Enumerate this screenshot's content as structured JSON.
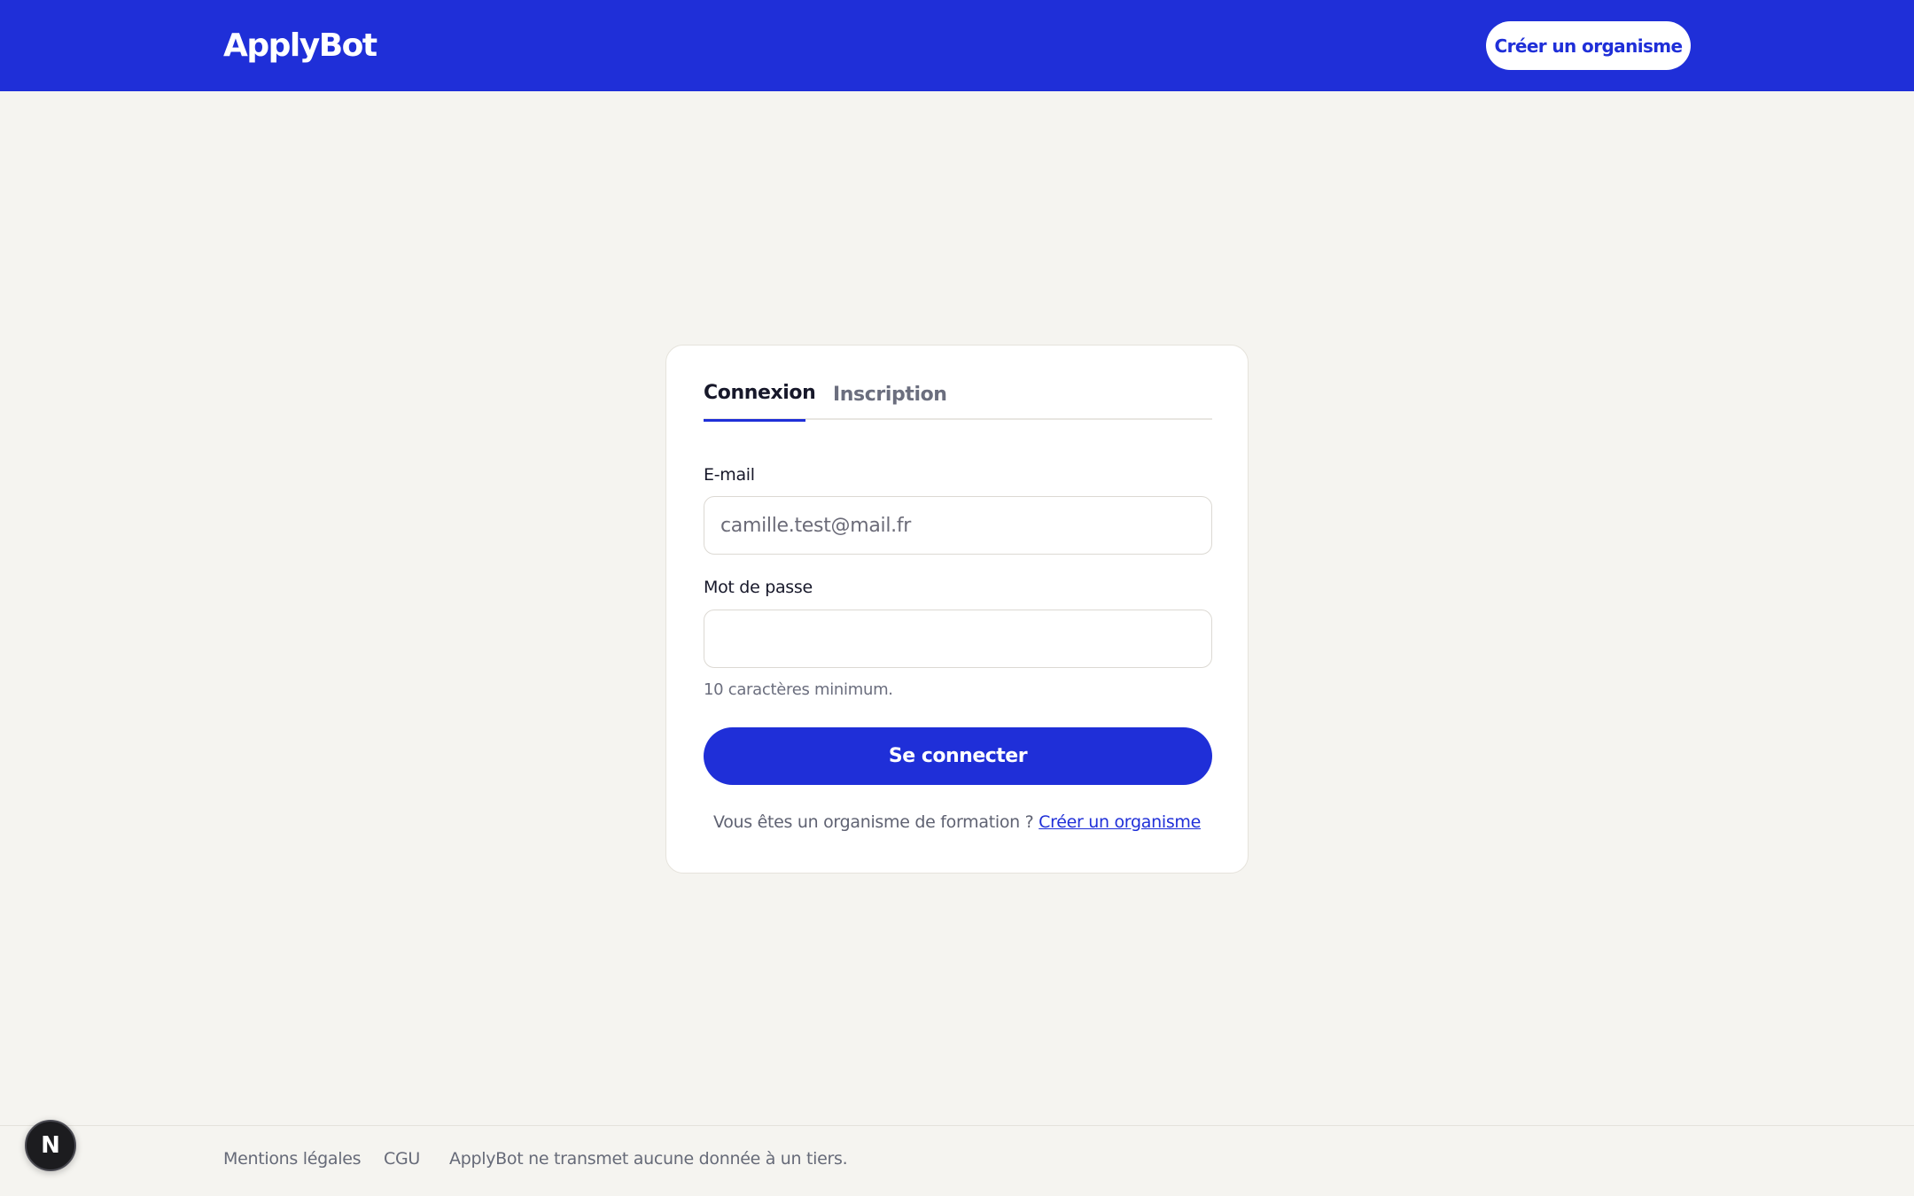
{
  "header": {
    "logo": "ApplyBot",
    "create_org_button": "Créer un organisme"
  },
  "auth": {
    "tabs": [
      {
        "label": "Connexion",
        "active": true
      },
      {
        "label": "Inscription",
        "active": false
      }
    ],
    "email_label": "E-mail",
    "email_value": "camille.test@mail.fr",
    "password_label": "Mot de passe",
    "password_value": "",
    "password_hint": "10 caractères minimum.",
    "submit_label": "Se connecter",
    "org_prompt": "Vous êtes un organisme de formation ?",
    "org_link": "Créer un organisme"
  },
  "footer": {
    "legal": "Mentions légales",
    "cgu": "CGU",
    "privacy_note": "ApplyBot ne transmet aucune donnée à un tiers."
  },
  "dev_badge": {
    "letter": "N",
    "icon": "next-logo-icon"
  },
  "colors": {
    "accent": "#1f2fd8",
    "background": "#f5f4f0"
  }
}
